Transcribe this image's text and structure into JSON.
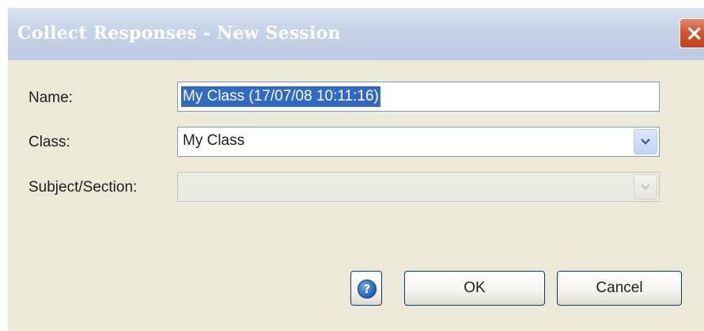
{
  "window": {
    "title": "Collect Responses - New Session",
    "close_icon": "×"
  },
  "form": {
    "name_label": "Name:",
    "name_value": "My Class (17/07/08 10:11:16)",
    "class_label": "Class:",
    "class_value": "My Class",
    "subject_label": "Subject/Section:",
    "subject_value": ""
  },
  "buttons": {
    "help_icon": "?",
    "ok_label": "OK",
    "cancel_label": "Cancel"
  },
  "colors": {
    "dialog_bg": "#ece9d8",
    "title_bar": "#c4d1e6",
    "selection": "#316ac5",
    "close_red": "#d0562e"
  }
}
